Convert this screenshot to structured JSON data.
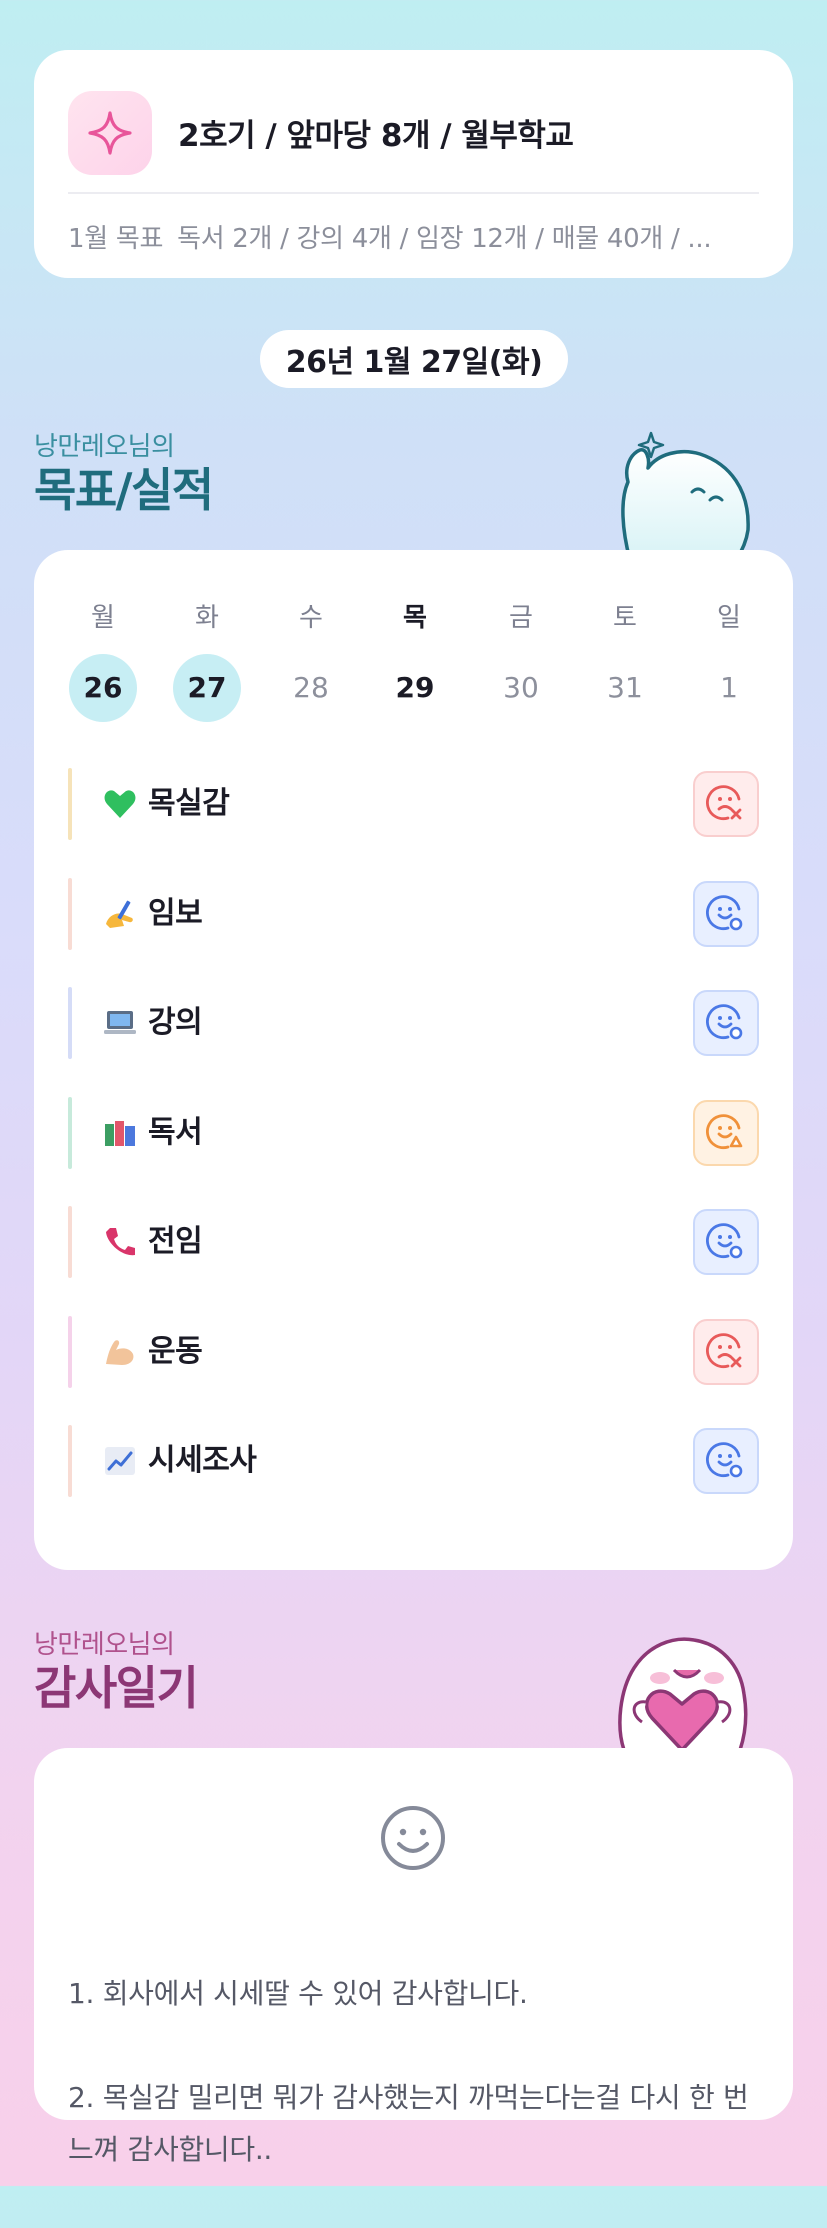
{
  "header": {
    "title": "2호기 / 앞마당 8개 / 월부학교",
    "goal_label": "1월 목표",
    "goal_text": "독서 2개 / 강의 4개 / 임장 12개 / 매물 40개 / ...",
    "icon": "sparkle-icon"
  },
  "date": "26년 1월 27일(화)",
  "goals_section": {
    "subtitle": "낭만레오님의",
    "title": "목표/실적",
    "week": [
      {
        "day": "월",
        "num": "26",
        "state": "circle"
      },
      {
        "day": "화",
        "num": "27",
        "state": "circle"
      },
      {
        "day": "수",
        "num": "28",
        "state": "plain"
      },
      {
        "day": "목",
        "num": "29",
        "state": "today"
      },
      {
        "day": "금",
        "num": "30",
        "state": "plain"
      },
      {
        "day": "토",
        "num": "31",
        "state": "plain"
      },
      {
        "day": "일",
        "num": "1",
        "state": "plain"
      }
    ],
    "items": [
      {
        "emoji": "green-heart-icon",
        "label": "목실감",
        "bar_color": "#f6e3b9",
        "status": "fail"
      },
      {
        "emoji": "writing-hand-icon",
        "label": "임보",
        "bar_color": "#f8dcd4",
        "status": "done"
      },
      {
        "emoji": "laptop-icon",
        "label": "강의",
        "bar_color": "#d5dcf7",
        "status": "done"
      },
      {
        "emoji": "books-icon",
        "label": "독서",
        "bar_color": "#c7eadb",
        "status": "partial"
      },
      {
        "emoji": "phone-icon",
        "label": "전임",
        "bar_color": "#f8dcd4",
        "status": "done"
      },
      {
        "emoji": "flexed-biceps-icon",
        "label": "운동",
        "bar_color": "#f5d2ea",
        "status": "fail"
      },
      {
        "emoji": "chart-increasing-icon",
        "label": "시세조사",
        "bar_color": "#f8dcd4",
        "status": "done"
      }
    ]
  },
  "diary_section": {
    "subtitle": "낭만레오님의",
    "title": "감사일기",
    "mood_icon": "smile-face-icon",
    "entries": [
      "1. 회사에서 시세딸 수 있어 감사합니다.",
      "2. 목실감 밀리면 뭐가 감사했는지 까먹는다는걸 다시 한 번 느껴 감사합니다.."
    ]
  },
  "colors": {
    "done": "#4a78e6",
    "fail": "#e85a5a",
    "partial": "#f0913a",
    "teal_title": "#1f6c7d",
    "pink_title": "#8c3775"
  }
}
